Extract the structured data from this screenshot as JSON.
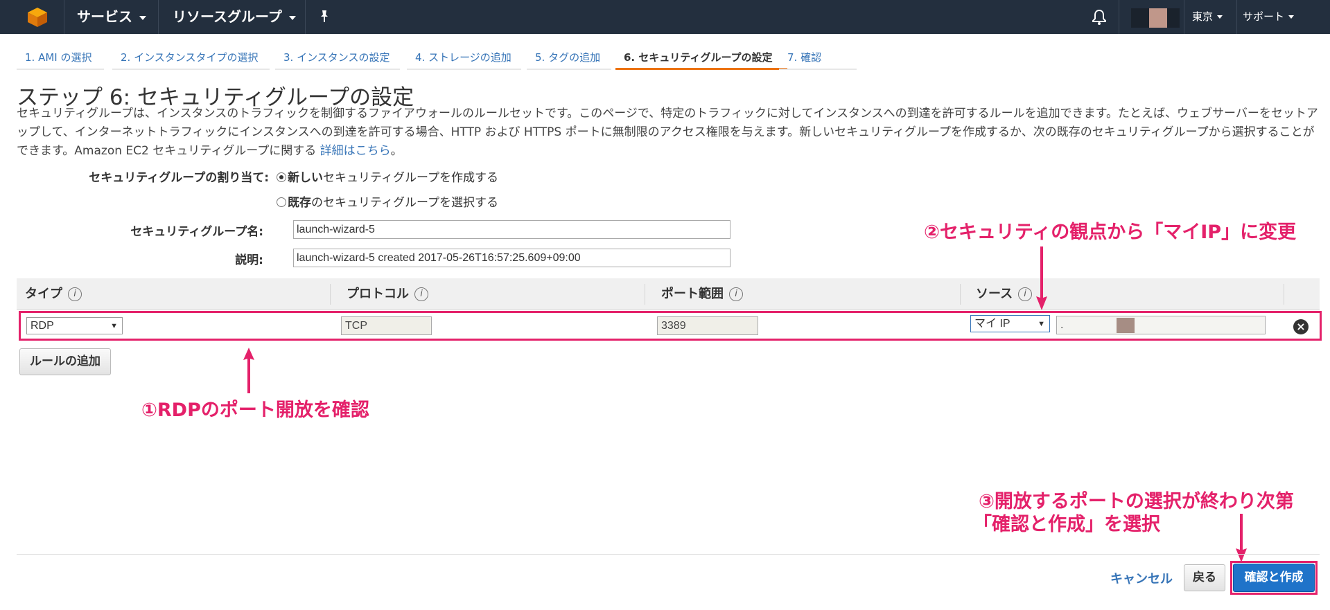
{
  "topbar": {
    "services_label": "サービス",
    "resource_groups_label": "リソースグループ",
    "region_label": "東京",
    "support_label": "サポート"
  },
  "tabs": [
    {
      "label": "1. AMI の選択"
    },
    {
      "label": "2. インスタンスタイプの選択"
    },
    {
      "label": "3. インスタンスの設定"
    },
    {
      "label": "4. ストレージの追加"
    },
    {
      "label": "5. タグの追加"
    },
    {
      "label": "6. セキュリティグループの設定"
    },
    {
      "label": "7. 確認"
    }
  ],
  "page": {
    "title": "ステップ 6: セキュリティグループの設定",
    "description": "セキュリティグループは、インスタンスのトラフィックを制御するファイアウォールのルールセットです。このページで、特定のトラフィックに対してインスタンスへの到達を許可するルールを追加できます。たとえば、ウェブサーバーをセットアップして、インターネットトラフィックにインスタンスへの到達を許可する場合、HTTP および HTTPS ポートに無制限のアクセス権限を与えます。新しいセキュリティグループを作成するか、次の既存のセキュリティグループから選択することができます。Amazon EC2 セキュリティグループに関する ",
    "details_link": "詳細はこちら",
    "details_suffix": "。"
  },
  "form": {
    "assign_label": "セキュリティグループの割り当て:",
    "radio_new_bold": "新しい",
    "radio_new_rest": "セキュリティグループを作成する",
    "radio_existing_bold": "既存",
    "radio_existing_rest": "のセキュリティグループを選択する",
    "name_label": "セキュリティグループ名:",
    "name_value": "launch-wizard-5",
    "desc_label": "説明:",
    "desc_value": "launch-wizard-5 created 2017-05-26T16:57:25.609+09:00"
  },
  "table": {
    "headers": [
      "タイプ",
      "プロトコル",
      "ポート範囲",
      "ソース"
    ],
    "row": {
      "type": "RDP",
      "protocol": "TCP",
      "port": "3389",
      "source": "マイ IP",
      "source_ip": "."
    }
  },
  "buttons": {
    "add_rule": "ルールの追加",
    "cancel": "キャンセル",
    "back": "戻る",
    "review_launch": "確認と作成"
  },
  "annotations": {
    "note1": "①RDPのポート開放を確認",
    "note2": "②セキュリティの観点から「マイIP」に変更",
    "note3_line1": "③開放するポートの選択が終わり次第",
    "note3_line2": "「確認と作成」を選択",
    "color": "#e4216a"
  },
  "colors": {
    "topbar": "#232f3e",
    "accent_tab": "#ec7211",
    "primary_button": "#1f73c9",
    "link": "#3674b7"
  }
}
